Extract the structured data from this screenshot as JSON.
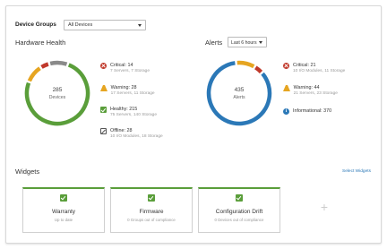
{
  "filters": {
    "group_label": "Device Groups",
    "group_value": "All Devices"
  },
  "hardware_health": {
    "title": "Hardware Health",
    "center_count": "285",
    "center_label": "Devices",
    "colors": {
      "healthy": "#5a9e3a",
      "warning": "#e6a521",
      "critical": "#c0392b",
      "offline": "#8a8a8a",
      "track": "#e0e0e0"
    },
    "segments": [
      {
        "status": "healthy",
        "value": 215
      },
      {
        "status": "warning",
        "value": 28
      },
      {
        "status": "critical",
        "value": 14
      },
      {
        "status": "offline",
        "value": 28
      }
    ],
    "legend": [
      {
        "icon": "critical-icon",
        "main": "Critical: 14",
        "sub": "7 Servers, 7 Storage"
      },
      {
        "icon": "warning-icon",
        "main": "Warning: 28",
        "sub": "17 Servers, 11 Storage"
      },
      {
        "icon": "healthy-icon",
        "main": "Healthy: 215",
        "sub": "75 Servers, 140 Storage"
      },
      {
        "icon": "offline-icon",
        "main": "Offline: 28",
        "sub": "10 I/O Modules, 18 Storage"
      }
    ]
  },
  "alerts": {
    "title": "Alerts",
    "range_value": "Last 6 hours",
    "center_count": "435",
    "center_label": "Alerts",
    "colors": {
      "informational": "#2b78b7",
      "warning": "#e6a521",
      "critical": "#c0392b"
    },
    "segments": [
      {
        "status": "informational",
        "value": 370
      },
      {
        "status": "warning",
        "value": 44
      },
      {
        "status": "critical",
        "value": 21
      }
    ],
    "legend": [
      {
        "icon": "critical-icon",
        "main": "Critical: 21",
        "sub": "10 I/O Modules, 11 Storage"
      },
      {
        "icon": "warning-icon",
        "main": "Warning: 44",
        "sub": "21 Servers, 23 Storage"
      },
      {
        "icon": "info-icon",
        "main": "Informational: 370",
        "sub": ""
      }
    ]
  },
  "widgets": {
    "title": "Widgets",
    "select_link": "Select Widgets",
    "add_symbol": "+",
    "items": [
      {
        "title": "Warranty",
        "sub": "Up to date"
      },
      {
        "title": "Firmware",
        "sub": "0 Groups out of compliance"
      },
      {
        "title": "Configuration Drift",
        "sub": "0 Devices out of compliance"
      }
    ]
  }
}
